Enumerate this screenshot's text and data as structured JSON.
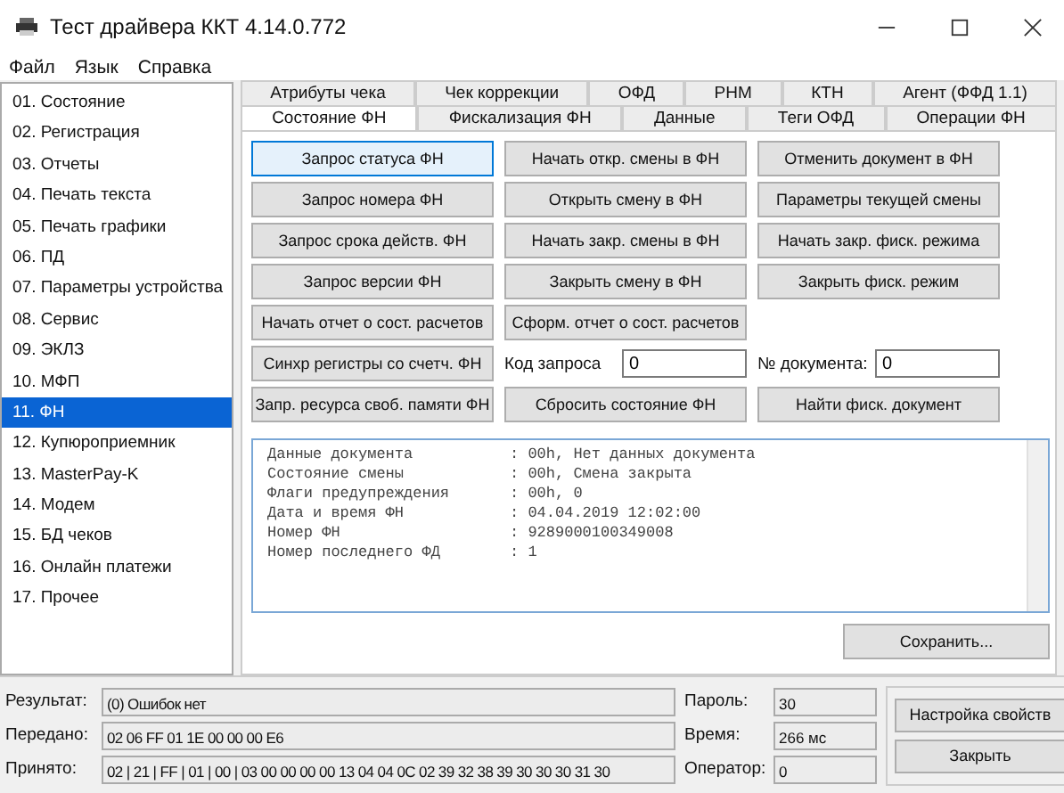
{
  "window": {
    "title": "Тест драйвера ККТ 4.14.0.772"
  },
  "menu": [
    "Файл",
    "Язык",
    "Справка"
  ],
  "sidebar": {
    "items": [
      {
        "label": "01. Состояние",
        "selected": false
      },
      {
        "label": "02. Регистрация",
        "selected": false
      },
      {
        "label": "03. Отчеты",
        "selected": false
      },
      {
        "label": "04. Печать текста",
        "selected": false
      },
      {
        "label": "05. Печать графики",
        "selected": false
      },
      {
        "label": "06. ПД",
        "selected": false
      },
      {
        "label": "07. Параметры устройства",
        "selected": false
      },
      {
        "label": "08. Сервис",
        "selected": false
      },
      {
        "label": "09. ЭКЛЗ",
        "selected": false
      },
      {
        "label": "10. МФП",
        "selected": false
      },
      {
        "label": "11. ФН",
        "selected": true
      },
      {
        "label": "12. Купюроприемник",
        "selected": false
      },
      {
        "label": "13. MasterPay-K",
        "selected": false
      },
      {
        "label": "14. Модем",
        "selected": false
      },
      {
        "label": "15. БД чеков",
        "selected": false
      },
      {
        "label": "16. Онлайн платежи",
        "selected": false
      },
      {
        "label": "17. Прочее",
        "selected": false
      }
    ]
  },
  "tab_rows": [
    [
      {
        "label": "Атрибуты чека",
        "selected": false
      },
      {
        "label": "Чек коррекции",
        "selected": false
      },
      {
        "label": "ОФД",
        "selected": false
      },
      {
        "label": "РНМ",
        "selected": false
      },
      {
        "label": "КТН",
        "selected": false
      },
      {
        "label": "Агент (ФФД 1.1)",
        "selected": false
      }
    ],
    [
      {
        "label": "Состояние ФН",
        "selected": true
      },
      {
        "label": "Фискализация ФН",
        "selected": false
      },
      {
        "label": "Данные",
        "selected": false
      },
      {
        "label": "Теги ОФД",
        "selected": false
      },
      {
        "label": "Операции ФН",
        "selected": false
      }
    ]
  ],
  "grid": [
    [
      {
        "kind": "button",
        "label": "Запрос статуса ФН",
        "highlighted": true
      },
      {
        "kind": "button",
        "label": "Начать откр. смены в ФН",
        "highlighted": false
      },
      {
        "kind": "button",
        "label": "Отменить документ в ФН",
        "highlighted": false
      }
    ],
    [
      {
        "kind": "button",
        "label": "Запрос номера ФН",
        "highlighted": false
      },
      {
        "kind": "button",
        "label": "Открыть смену в ФН",
        "highlighted": false
      },
      {
        "kind": "button",
        "label": "Параметры текущей смены",
        "highlighted": false
      }
    ],
    [
      {
        "kind": "button",
        "label": "Запрос срока действ. ФН",
        "highlighted": false
      },
      {
        "kind": "button",
        "label": "Начать закр. смены в ФН",
        "highlighted": false
      },
      {
        "kind": "button",
        "label": "Начать закр. фиск. режима",
        "highlighted": false
      }
    ],
    [
      {
        "kind": "button",
        "label": "Запрос версии ФН",
        "highlighted": false
      },
      {
        "kind": "button",
        "label": "Закрыть смену в ФН",
        "highlighted": false
      },
      {
        "kind": "button",
        "label": "Закрыть фиск. режим",
        "highlighted": false
      }
    ],
    [
      {
        "kind": "button",
        "label": "Начать отчет о сост. расчетов",
        "highlighted": false
      },
      {
        "kind": "button",
        "label": "Сформ. отчет о сост. расчетов",
        "highlighted": false
      }
    ],
    [
      {
        "kind": "button",
        "label": "Синхр регистры со счетч. ФН",
        "highlighted": false
      },
      {
        "kind": "field",
        "label": "Код запроса",
        "value": "0"
      },
      {
        "kind": "field",
        "label": "№ документа:",
        "value": "0"
      }
    ],
    [
      {
        "kind": "button",
        "label": "Запр. ресурса своб. памяти ФН",
        "highlighted": false
      },
      {
        "kind": "button",
        "label": "Сбросить состояние ФН",
        "highlighted": false
      },
      {
        "kind": "button",
        "label": "Найти фиск. документ",
        "highlighted": false
      }
    ]
  ],
  "output": [
    {
      "name": "Данные документа",
      "value": ": 00h, Нет данных документа"
    },
    {
      "name": "Состояние смены",
      "value": ": 00h, Смена закрыта"
    },
    {
      "name": "Флаги предупреждения",
      "value": ": 00h, 0"
    },
    {
      "name": "Дата и время ФН",
      "value": ": 04.04.2019 12:02:00"
    },
    {
      "name": "Номер ФН",
      "value": ": 9289000100349008"
    },
    {
      "name": "Номер последнего ФД",
      "value": ": 1"
    }
  ],
  "save_button": "Сохранить...",
  "status": {
    "left": [
      {
        "label": "Результат:",
        "value": "(0) Ошибок нет"
      },
      {
        "label": "Передано:",
        "value": "02 06 FF 01 1E 00 00 00 E6"
      },
      {
        "label": "Принято:",
        "value": "02 | 21 | FF | 01 | 00 | 03 00 00 00 00 13 04 04 0C 02 39 32 38 39 30 30 30 31 30"
      }
    ],
    "right": [
      {
        "label": "Пароль:",
        "value": "30"
      },
      {
        "label": "Время:",
        "value": "266 мс"
      },
      {
        "label": "Оператор:",
        "value": "0"
      }
    ],
    "buttons": [
      "Настройка свойств",
      "Закрыть"
    ]
  }
}
